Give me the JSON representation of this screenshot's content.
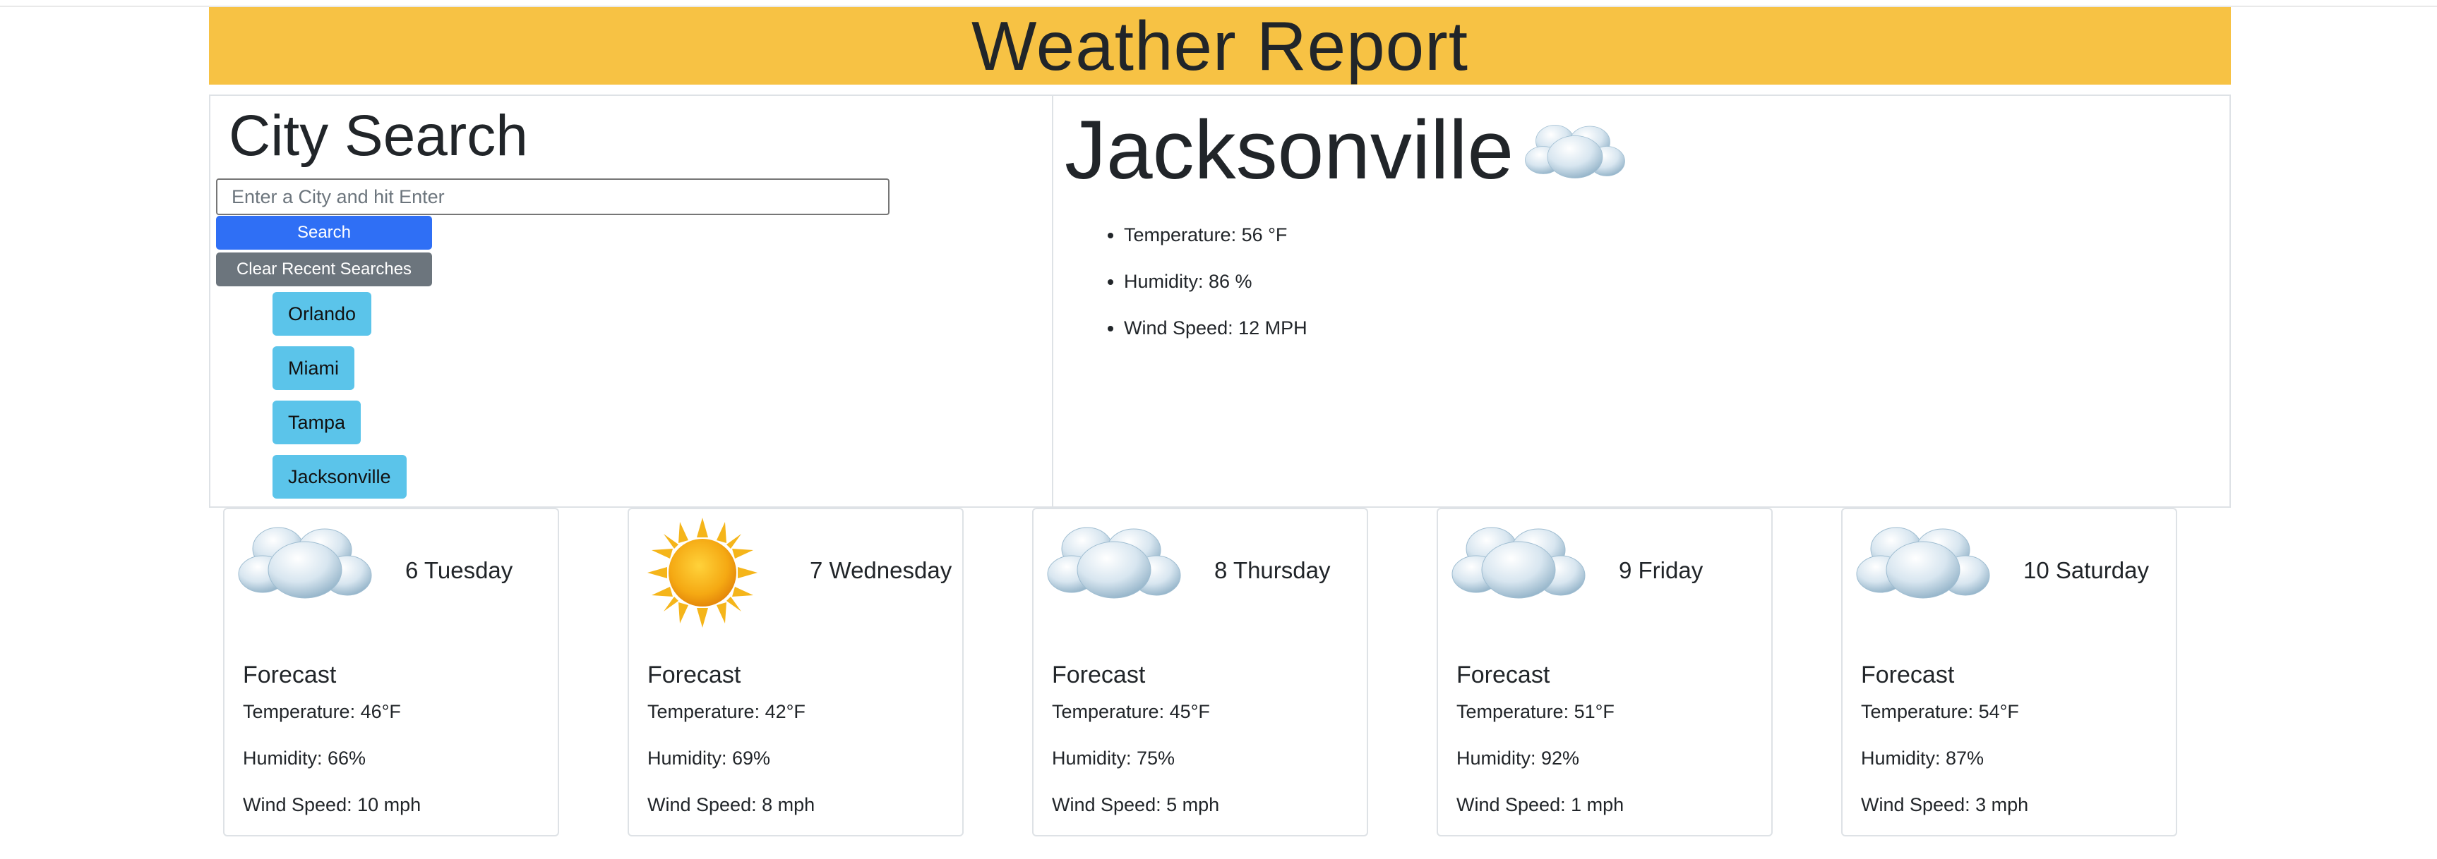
{
  "header": {
    "title": "Weather Report"
  },
  "search": {
    "heading": "City Search",
    "placeholder": "Enter a City and hit Enter",
    "search_label": "Search",
    "clear_label": "Clear Recent Searches",
    "recent": [
      "Orlando",
      "Miami",
      "Tampa",
      "Jacksonville"
    ]
  },
  "current": {
    "city": "Jacksonville",
    "icon": "cloud-icon",
    "temperature": "Temperature: 56 °F",
    "humidity": "Humidity: 86 %",
    "wind": "Wind Speed: 12 MPH"
  },
  "forecast": [
    {
      "day": "6 Tuesday",
      "icon": "cloud-icon",
      "label": "Forecast",
      "temp": "Temperature: 46°F",
      "humidity": "Humidity: 66%",
      "wind": "Wind Speed: 10 mph"
    },
    {
      "day": "7 Wednesday",
      "icon": "sun-icon",
      "label": "Forecast",
      "temp": "Temperature: 42°F",
      "humidity": "Humidity: 69%",
      "wind": "Wind Speed: 8 mph"
    },
    {
      "day": "8 Thursday",
      "icon": "cloud-icon",
      "label": "Forecast",
      "temp": "Temperature: 45°F",
      "humidity": "Humidity: 75%",
      "wind": "Wind Speed: 5 mph"
    },
    {
      "day": "9 Friday",
      "icon": "cloud-icon",
      "label": "Forecast",
      "temp": "Temperature: 51°F",
      "humidity": "Humidity: 92%",
      "wind": "Wind Speed: 1 mph"
    },
    {
      "day": "10 Saturday",
      "icon": "cloud-icon",
      "label": "Forecast",
      "temp": "Temperature: 54°F",
      "humidity": "Humidity: 87%",
      "wind": "Wind Speed: 3 mph"
    }
  ],
  "colors": {
    "header_bg": "#f7c244",
    "search_button": "#2f6ff5",
    "clear_button": "#6c757d",
    "recent_chip": "#5bc4ea"
  }
}
